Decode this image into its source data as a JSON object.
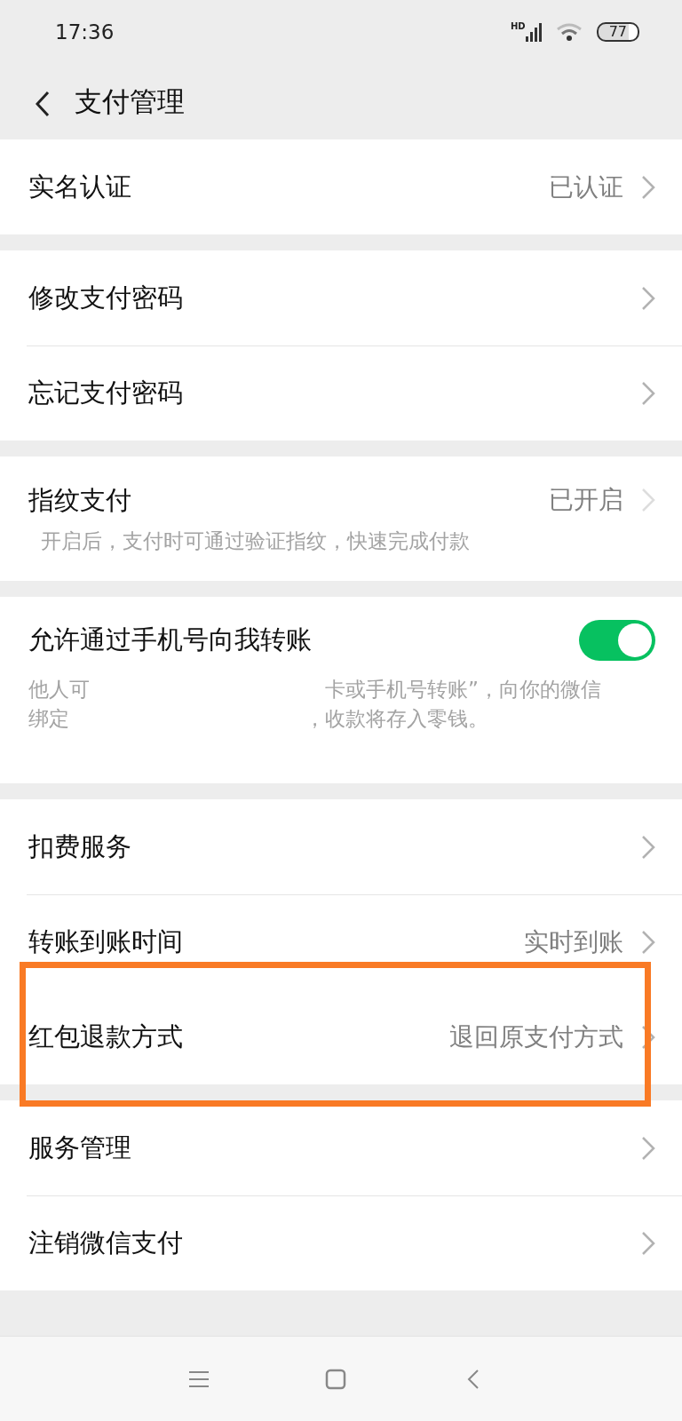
{
  "status_bar": {
    "time": "17:36",
    "network": "HD",
    "battery": "77"
  },
  "header": {
    "title": "支付管理"
  },
  "groups": [
    {
      "items": [
        {
          "kind": "link",
          "label": "实名认证",
          "value": "已认证",
          "highlighted": false
        }
      ]
    },
    {
      "items": [
        {
          "kind": "link",
          "label": "修改支付密码",
          "highlighted": false
        },
        {
          "kind": "link",
          "label": "忘记支付密码",
          "highlighted": false
        }
      ]
    },
    {
      "items": [
        {
          "kind": "link",
          "label": "指纹支付",
          "value": "已开启",
          "description": "开启后，支付时可通过验证指纹，快速完成付款",
          "highlighted": false
        }
      ]
    },
    {
      "items": [
        {
          "kind": "toggle",
          "label": "允许通过手机号向我转账",
          "on": true,
          "description_lines": [
            [
              {
                "kind": "text",
                "text": "他人可"
              },
              {
                "kind": "redacted"
              },
              {
                "kind": "text",
                "text": "卡或手机号转账”，向你的微信"
              }
            ],
            [
              {
                "kind": "text",
                "text": "绑定"
              },
              {
                "kind": "redacted"
              },
              {
                "kind": "text",
                "text": "，收款将存入零钱。"
              }
            ]
          ]
        }
      ]
    },
    {
      "items": [
        {
          "kind": "link",
          "label": "扣费服务",
          "highlighted": false
        },
        {
          "kind": "link",
          "label": "转账到账时间",
          "value": "实时到账",
          "highlighted": false
        },
        {
          "kind": "link",
          "label": "红包退款方式",
          "value": "退回原支付方式",
          "highlighted": true
        }
      ]
    },
    {
      "items": [
        {
          "kind": "link",
          "label": "服务管理",
          "highlighted": false
        },
        {
          "kind": "link",
          "label": "注销微信支付",
          "highlighted": false
        }
      ]
    }
  ]
}
